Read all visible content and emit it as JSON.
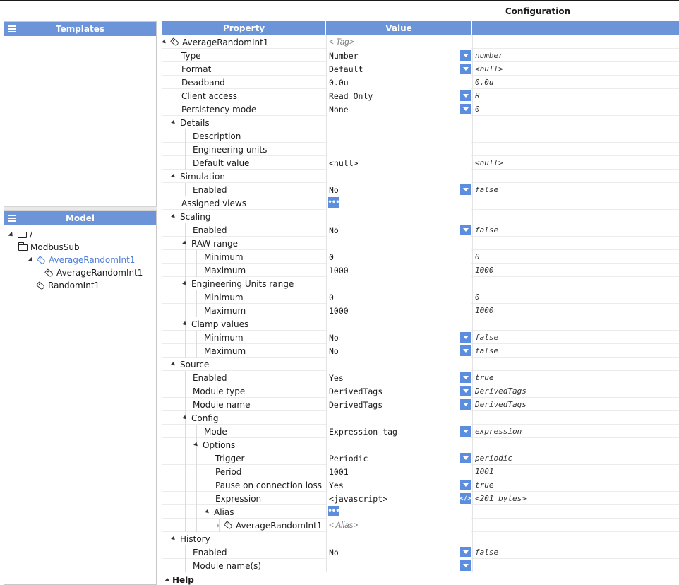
{
  "config_title": "Configuration",
  "templates": {
    "title": "Templates"
  },
  "model": {
    "title": "Model",
    "tree": [
      {
        "label": "/",
        "icon": "folder-icon",
        "level": 0,
        "expander": "open",
        "selected": false
      },
      {
        "label": "ModbusSub",
        "icon": "folder-icon",
        "level": 1,
        "expander": "none",
        "selected": false
      },
      {
        "label": "AverageRandomInt1",
        "icon": "tag-icon",
        "level": 2,
        "expander": "open",
        "selected": true
      },
      {
        "label": "AverageRandomInt1",
        "icon": "tag-icon",
        "level": 3,
        "expander": "none",
        "selected": false
      },
      {
        "label": "RandomInt1",
        "icon": "tag-icon",
        "level": 2,
        "expander": "none",
        "selected": false,
        "noindent": true
      }
    ]
  },
  "grid": {
    "headers": {
      "property": "Property",
      "value": "Value",
      "raw": ""
    },
    "rows": [
      {
        "label": "AverageRandomInt1",
        "level": 0,
        "expander": "open",
        "icon": "tag-icon",
        "value": "< Tag>",
        "value_style": "italic",
        "raw": "",
        "ctrl": ""
      },
      {
        "label": "Type",
        "level": 1,
        "expander": "",
        "value": "Number",
        "raw": "number",
        "ctrl": "dropdown"
      },
      {
        "label": "Format",
        "level": 1,
        "expander": "",
        "value": "Default",
        "raw": "<null>",
        "ctrl": "dropdown"
      },
      {
        "label": "Deadband",
        "level": 1,
        "expander": "",
        "value": "0.0u",
        "raw": "0.0u",
        "ctrl": ""
      },
      {
        "label": "Client access",
        "level": 1,
        "expander": "",
        "value": "Read Only",
        "raw": "R",
        "ctrl": "dropdown"
      },
      {
        "label": "Persistency mode",
        "level": 1,
        "expander": "",
        "value": "None",
        "raw": "0",
        "ctrl": "dropdown"
      },
      {
        "label": "Details",
        "level": 1,
        "expander": "open",
        "value": "",
        "raw": "",
        "ctrl": ""
      },
      {
        "label": "Description",
        "level": 2,
        "expander": "",
        "value": "",
        "raw": "",
        "ctrl": ""
      },
      {
        "label": "Engineering units",
        "level": 2,
        "expander": "",
        "value": "",
        "raw": "",
        "ctrl": ""
      },
      {
        "label": "Default value",
        "level": 2,
        "expander": "",
        "value": "<null>",
        "raw": "<null>",
        "ctrl": ""
      },
      {
        "label": "Simulation",
        "level": 1,
        "expander": "open",
        "value": "",
        "raw": "",
        "ctrl": ""
      },
      {
        "label": "Enabled",
        "level": 2,
        "expander": "",
        "value": "No",
        "raw": "false",
        "ctrl": "dropdown"
      },
      {
        "label": "Assigned views",
        "level": 1,
        "expander": "",
        "value": "",
        "raw": "",
        "ctrl": "dots"
      },
      {
        "label": "Scaling",
        "level": 1,
        "expander": "open",
        "value": "",
        "raw": "",
        "ctrl": ""
      },
      {
        "label": "Enabled",
        "level": 2,
        "expander": "",
        "value": "No",
        "raw": "false",
        "ctrl": "dropdown"
      },
      {
        "label": "RAW range",
        "level": 2,
        "expander": "open",
        "value": "",
        "raw": "",
        "ctrl": ""
      },
      {
        "label": "Minimum",
        "level": 3,
        "expander": "",
        "value": "0",
        "raw": "0",
        "ctrl": ""
      },
      {
        "label": "Maximum",
        "level": 3,
        "expander": "",
        "value": "1000",
        "raw": "1000",
        "ctrl": ""
      },
      {
        "label": "Engineering Units range",
        "level": 2,
        "expander": "open",
        "value": "",
        "raw": "",
        "ctrl": ""
      },
      {
        "label": "Minimum",
        "level": 3,
        "expander": "",
        "value": "0",
        "raw": "0",
        "ctrl": ""
      },
      {
        "label": "Maximum",
        "level": 3,
        "expander": "",
        "value": "1000",
        "raw": "1000",
        "ctrl": ""
      },
      {
        "label": "Clamp values",
        "level": 2,
        "expander": "open",
        "value": "",
        "raw": "",
        "ctrl": ""
      },
      {
        "label": "Minimum",
        "level": 3,
        "expander": "",
        "value": "No",
        "raw": "false",
        "ctrl": "dropdown"
      },
      {
        "label": "Maximum",
        "level": 3,
        "expander": "",
        "value": "No",
        "raw": "false",
        "ctrl": "dropdown"
      },
      {
        "label": "Source",
        "level": 1,
        "expander": "open",
        "value": "",
        "raw": "",
        "ctrl": ""
      },
      {
        "label": "Enabled",
        "level": 2,
        "expander": "",
        "value": "Yes",
        "raw": "true",
        "ctrl": "dropdown"
      },
      {
        "label": "Module type",
        "level": 2,
        "expander": "",
        "value": "DerivedTags",
        "raw": "DerivedTags",
        "ctrl": "dropdown"
      },
      {
        "label": "Module name",
        "level": 2,
        "expander": "",
        "value": "DerivedTags",
        "raw": "DerivedTags",
        "ctrl": "dropdown"
      },
      {
        "label": "Config",
        "level": 2,
        "expander": "open",
        "value": "",
        "raw": "",
        "ctrl": ""
      },
      {
        "label": "Mode",
        "level": 3,
        "expander": "",
        "value": "Expression tag",
        "raw": "expression",
        "ctrl": "dropdown"
      },
      {
        "label": "Options",
        "level": 3,
        "expander": "open",
        "value": "",
        "raw": "",
        "ctrl": ""
      },
      {
        "label": "Trigger",
        "level": 4,
        "expander": "",
        "value": "Periodic",
        "raw": "periodic",
        "ctrl": "dropdown"
      },
      {
        "label": "Period",
        "level": 4,
        "expander": "",
        "value": "1001",
        "raw": "1001",
        "ctrl": ""
      },
      {
        "label": "Pause on connection loss",
        "level": 4,
        "expander": "",
        "value": "Yes",
        "raw": "true",
        "ctrl": "dropdown"
      },
      {
        "label": "Expression",
        "level": 4,
        "expander": "",
        "value": "<javascript>",
        "raw": "<201 bytes>",
        "ctrl": "code"
      },
      {
        "label": "Alias",
        "level": 4,
        "expander": "open",
        "value": "",
        "raw": "",
        "ctrl": "dots"
      },
      {
        "label": "AverageRandomInt1",
        "level": 5,
        "expander": "closed",
        "icon": "tag-icon",
        "value": "< Alias>",
        "value_style": "italic",
        "raw": "",
        "ctrl": ""
      },
      {
        "label": "History",
        "level": 1,
        "expander": "open",
        "value": "",
        "raw": "",
        "ctrl": ""
      },
      {
        "label": "Enabled",
        "level": 2,
        "expander": "",
        "value": "No",
        "raw": "false",
        "ctrl": "dropdown"
      },
      {
        "label": "Module name(s)",
        "level": 2,
        "expander": "",
        "value": "",
        "raw": "",
        "ctrl": "dropdown"
      }
    ]
  },
  "help": {
    "label": "Help"
  },
  "colors": {
    "header": "#6b95d8",
    "button": "#5b8ede",
    "selected": "#4f7fd6"
  }
}
